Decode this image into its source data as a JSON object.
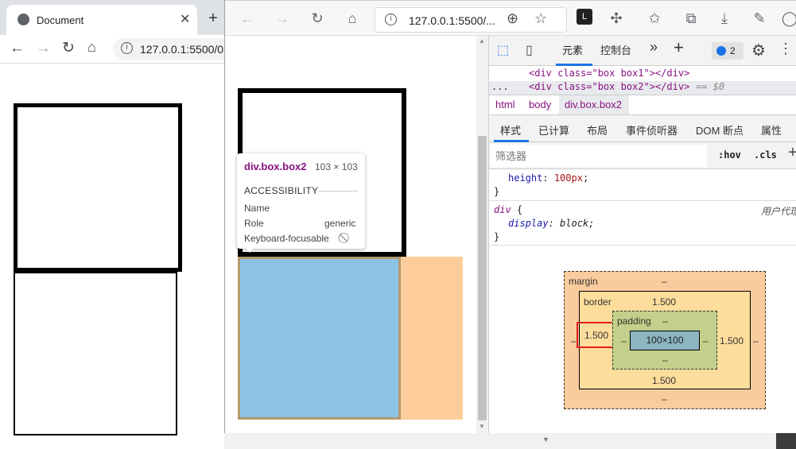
{
  "back_window": {
    "tab_title": "Document",
    "new_tab": "+",
    "address": "127.0.0.1:5500/0",
    "icons": [
      "globe-icon",
      "close-icon",
      "back-icon",
      "forward-icon",
      "reload-icon",
      "home-icon",
      "info-icon"
    ]
  },
  "front_window": {
    "address": "127.0.0.1:5500/...",
    "icons": [
      "back-icon",
      "forward-icon",
      "reload-icon",
      "home-icon",
      "info-icon",
      "zoom-icon",
      "add-favorite-icon",
      "screen-reader-icon",
      "extensions-icon",
      "favorites-icon",
      "collections-icon",
      "download-icon",
      "feedback-icon",
      "profile-icon"
    ]
  },
  "tooltip": {
    "title": "div.box.box2",
    "size": "103 × 103",
    "section": "ACCESSIBILITY",
    "rows": [
      {
        "label": "Name",
        "value": ""
      },
      {
        "label": "Role",
        "value": "generic"
      },
      {
        "label": "Keyboard-focusable",
        "value": ""
      }
    ]
  },
  "devtools": {
    "tabs": [
      "元素",
      "控制台"
    ],
    "more": "»",
    "add": "+",
    "issues_count": "2",
    "dom_line1": "<div class=\"box box1\"></div>",
    "dom_line2": "<div class=\"box box2\"></div>",
    "dom_line2_suffix": "== $0",
    "dom_ellipsis": "...",
    "breadcrumbs": [
      "html",
      "body",
      "div.box.box2"
    ],
    "panel_tabs": [
      "样式",
      "已计算",
      "布局",
      "事件侦听器",
      "DOM 断点",
      "属性"
    ],
    "filter_placeholder": "筛选器",
    "hov": ":hov",
    "cls": ".cls",
    "styles": {
      "rule1_prop": "height",
      "rule1_val": "100px",
      "rule1_close": "}",
      "rule2_selector": "div",
      "rule2_open": "{",
      "rule2_origin": "用户代理",
      "rule2_prop": "display",
      "rule2_val": "block",
      "rule2_close": "}"
    },
    "box_model": {
      "margin_label": "margin",
      "margin_top": "–",
      "margin_bottom": "–",
      "margin_left": "–",
      "margin_right": "–",
      "border_label": "border",
      "border_top": "1.500",
      "border_bottom": "1.500",
      "border_left": "1.500",
      "border_right": "1.500",
      "padding_label": "padding",
      "padding_top": "–",
      "padding_bottom": "–",
      "padding_left": "–",
      "padding_right": "–",
      "content": "100×100",
      "highlight_color": "#e0201e"
    }
  },
  "colors": {
    "content_highlight": "#8cc2e4",
    "margin_highlight": "#fccd9b",
    "box_border": "#000000"
  }
}
